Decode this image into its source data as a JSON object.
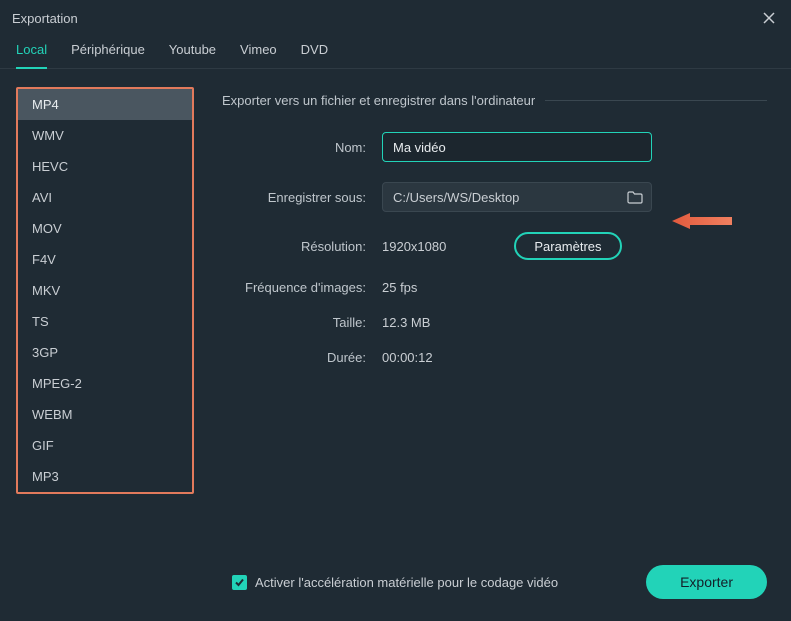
{
  "window": {
    "title": "Exportation"
  },
  "tabs": {
    "items": [
      {
        "label": "Local"
      },
      {
        "label": "Périphérique"
      },
      {
        "label": "Youtube"
      },
      {
        "label": "Vimeo"
      },
      {
        "label": "DVD"
      }
    ],
    "active_index": 0
  },
  "formats": {
    "items": [
      "MP4",
      "WMV",
      "HEVC",
      "AVI",
      "MOV",
      "F4V",
      "MKV",
      "TS",
      "3GP",
      "MPEG-2",
      "WEBM",
      "GIF",
      "MP3"
    ],
    "selected_index": 0
  },
  "section": {
    "heading": "Exporter vers un fichier et enregistrer dans l'ordinateur"
  },
  "fields": {
    "name": {
      "label": "Nom:",
      "value": "Ma vidéo"
    },
    "path": {
      "label": "Enregistrer sous:",
      "value": "C:/Users/WS/Desktop"
    },
    "res": {
      "label": "Résolution:",
      "value": "1920x1080"
    },
    "fps": {
      "label": "Fréquence d'images:",
      "value": "25 fps"
    },
    "size": {
      "label": "Taille:",
      "value": "12.3 MB"
    },
    "dur": {
      "label": "Durée:",
      "value": "00:00:12"
    }
  },
  "buttons": {
    "parameters": "Paramètres",
    "export": "Exporter"
  },
  "footer": {
    "hw_accel_label": "Activer l'accélération matérielle pour le codage vidéo",
    "hw_accel_checked": true
  },
  "colors": {
    "accent": "#22d3b8",
    "highlight_box": "#e27a5c",
    "arrow": "#e25a3d"
  }
}
